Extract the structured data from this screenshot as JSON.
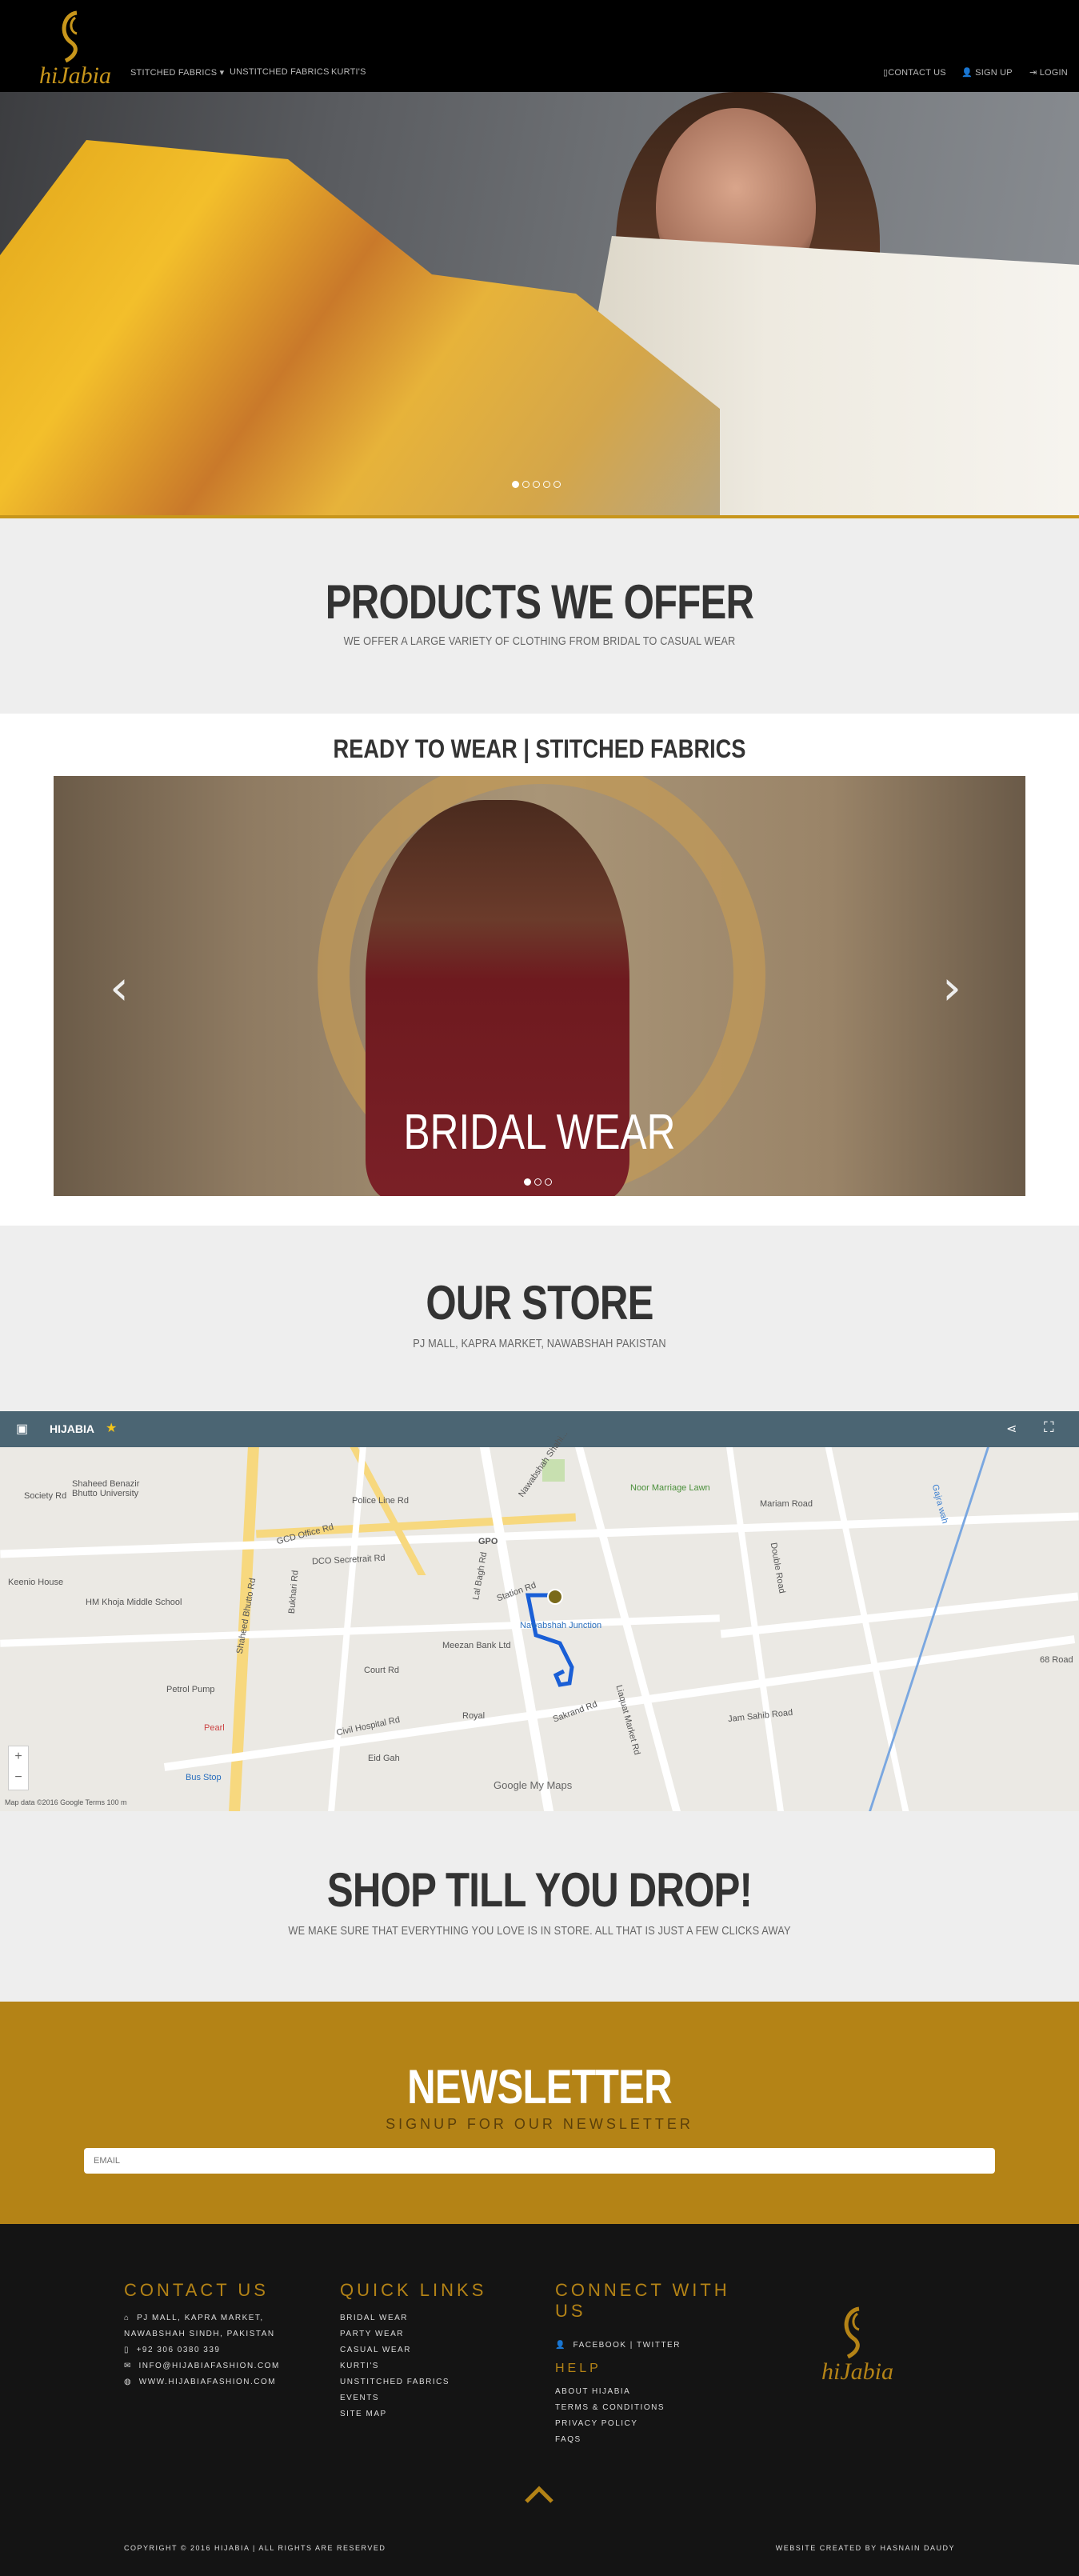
{
  "nav": {
    "brand": "Hijabia",
    "links": [
      "STITCHED FABRICS ▾",
      "UNSTITCHED FABRICS",
      "KURTI'S"
    ],
    "right": [
      "CONTACT US",
      "SIGN UP",
      "LOGIN"
    ]
  },
  "products": {
    "title": "PRODUCTS WE OFFER",
    "subtitle": "WE OFFER A LARGE VARIETY OF CLOTHING FROM BRIDAL TO CASUAL WEAR"
  },
  "ready": {
    "title": "READY TO WEAR | STITCHED FABRICS",
    "caption": "BRIDAL WEAR",
    "prev": "‹",
    "next": "›"
  },
  "store": {
    "title": "OUR STORE",
    "subtitle": "PJ MALL, KAPRA MARKET, NAWABSHAH PAKISTAN"
  },
  "map": {
    "title": "HIJABIA",
    "labels": [
      "Shaheed Benazir Bhutto University",
      "Society Rd",
      "Police Line Rd",
      "GPO",
      "Nawabshah Shahi...",
      "Noor Marriage Lawn",
      "Mariam Road",
      "Double Road",
      "Gajra wah",
      "Keenio House",
      "HM Khoja Middle School",
      "DCO Secretrait Rd",
      "GCD Office Rd",
      "Station Rd",
      "Meezan Bank Ltd",
      "Nawabshah Junction",
      "Court Rd",
      "Petrol Pump",
      "Royal",
      "Civil Hospital Rd",
      "Eid Gah",
      "Sakrand Rd",
      "Bus Stop",
      "Pearl",
      "Jam Sahib Road",
      "68 Road",
      "Shaheed Bhutto Rd",
      "Bukhari Rd",
      "Lal Bagh Rd",
      "Liaquat Market Rd"
    ],
    "footer": "Map data ©2016 Google   Terms   100 m",
    "google": "Google My Maps",
    "zoom_in": "+",
    "zoom_out": "−"
  },
  "shop": {
    "title": "SHOP TILL YOU DROP!",
    "subtitle": "WE MAKE SURE THAT EVERYTHING YOU LOVE IS IN STORE. ALL THAT IS JUST A FEW CLICKS AWAY"
  },
  "newsletter": {
    "title": "NEWSLETTER",
    "subtitle": "SIGNUP FOR OUR NEWSLETTER",
    "placeholder": "EMAIL"
  },
  "footer": {
    "contact_title": "CONTACT US",
    "contact": [
      "PJ MALL, KAPRA MARKET,",
      "NAWABSHAH SINDH, PAKISTAN",
      "+92 306 0380 339",
      "INFO@HIJABIAFASHION.COM",
      "WWW.HIJABIAFASHION.COM"
    ],
    "quick_title": "QUICK LINKS",
    "quick": [
      "BRIDAL WEAR",
      "PARTY WEAR",
      "CASUAL WEAR",
      "KURTI'S",
      "UNSTITCHED FABRICS",
      "EVENTS",
      "SITE MAP"
    ],
    "connect_title": "CONNECT WITH US",
    "connect": "FACEBOOK | TWITTER",
    "help_title": "HELP",
    "help": [
      "ABOUT HIJABIA",
      "TERMS & CONDITIONS",
      "PRIVACY POLICY",
      "FAQS"
    ],
    "copyright": "COPYRIGHT © 2016 HIJABIA | ALL RIGHTS ARE RESERVED",
    "credit": "WEBSITE CREATED BY HASNAIN DAUDY"
  },
  "colors": {
    "gold": "#b48316",
    "dark": "#141414"
  }
}
